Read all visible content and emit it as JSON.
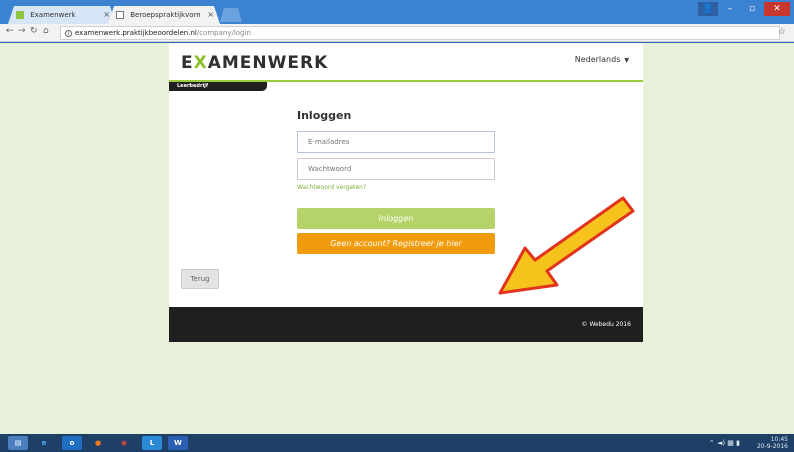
{
  "browser": {
    "tabs": [
      {
        "title": "Examenwerk",
        "close": "×"
      },
      {
        "title": "Beroepspraktijkvorming",
        "close": "×"
      }
    ],
    "address": {
      "host": "examenwerk.praktijkbeoordelen.nl",
      "path": "/company/login"
    },
    "window_controls": {
      "minimize": "–",
      "maximize": "▫",
      "close": "✕"
    }
  },
  "page": {
    "logo": {
      "pre": "E",
      "x": "X",
      "post": "AMENWERK"
    },
    "language": "Nederlands",
    "badge": "Leerbedrijf",
    "login_title": "Inloggen",
    "email_placeholder": "E-mailadres",
    "password_placeholder": "Wachtwoord",
    "forgot_link": "Wachtwoord vergeten?",
    "login_button": "Inloggen",
    "register_button": "Geen account? Registreer je hier",
    "back_button": "Terug",
    "copyright": "© Webedu 2016"
  },
  "colors": {
    "brand_green": "#9ccc3c",
    "login_green": "#b6d36a",
    "register_orange": "#f29b0c",
    "arrow_fill": "#f6c21c",
    "arrow_stroke": "#e0341d"
  },
  "taskbar": {
    "time": "10:45",
    "date": "20-9-2016"
  }
}
